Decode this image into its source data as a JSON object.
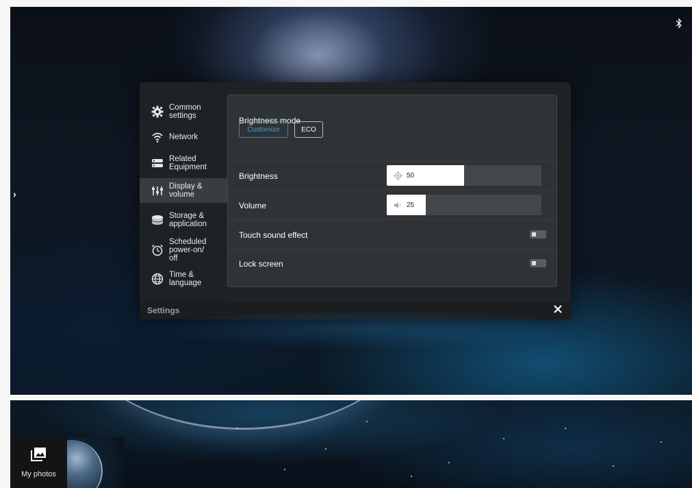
{
  "topbar": {
    "bluetooth_icon": "bluetooth-icon",
    "edge_arrow": "›"
  },
  "sidebar": {
    "items": [
      {
        "label": "Common\nsettings",
        "icon": "gear-icon",
        "active": false
      },
      {
        "label": "Network",
        "icon": "wifi-icon",
        "active": false
      },
      {
        "label": "Related\nEquipment",
        "icon": "equipment-icon",
        "active": false
      },
      {
        "label": "Display &\nvolume",
        "icon": "sliders-icon",
        "active": true
      },
      {
        "label": "Storage &\napplication",
        "icon": "storage-icon",
        "active": false
      },
      {
        "label": "Scheduled\npower-on/\noff",
        "icon": "alarm-clock-icon",
        "active": false
      },
      {
        "label": "Time &\nlanguage",
        "icon": "globe-icon",
        "active": false
      }
    ]
  },
  "main": {
    "brightness_mode": {
      "label": "Brightness mode",
      "options": [
        "Customize",
        "ECO"
      ],
      "selected": "Customize"
    },
    "brightness": {
      "label": "Brightness",
      "value": "50",
      "icon": "brightness-icon"
    },
    "volume": {
      "label": "Volume",
      "value": "25",
      "icon": "speaker-icon"
    },
    "touch_sound": {
      "label": "Touch sound effect",
      "enabled": false
    },
    "lock_screen": {
      "label": "Lock screen",
      "enabled": false
    }
  },
  "footer": {
    "title": "Settings",
    "close_icon": "close-icon"
  },
  "dock": {
    "photos_label": "My photos",
    "photos_icon": "photos-icon"
  },
  "colors": {
    "accent": "#4a9ad0",
    "dialog_bg": "#202326",
    "panel_bg": "#303336",
    "active_item": "#3a3d40"
  }
}
